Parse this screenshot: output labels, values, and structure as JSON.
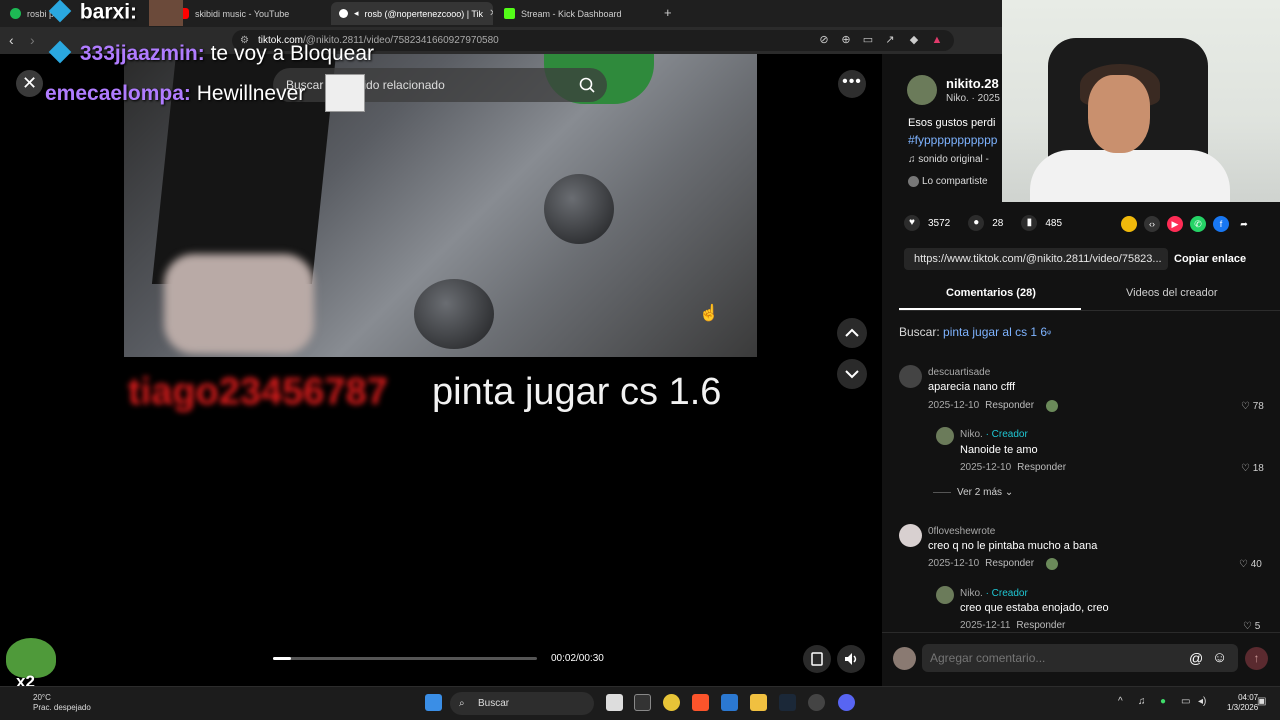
{
  "browser": {
    "tabs": [
      {
        "label": "rosbi pl...",
        "favicon_color": "#1db954",
        "active": false
      },
      {
        "label": "skibidi music - YouTube",
        "favicon_color": "#ff0000",
        "active": false
      },
      {
        "label": "rosb (@nopertenezcooo) | Tik",
        "favicon_color": "#ffffff",
        "active": true
      },
      {
        "label": "Stream - Kick Dashboard",
        "favicon_color": "#53fc18",
        "active": false
      }
    ],
    "new_tab": "+",
    "url_prefix": "tiktok.com",
    "url_path": "/@nikito.2811/video/7582341660927970580"
  },
  "chat_overlay": [
    {
      "user": "barxi:",
      "message": "",
      "user_color": "#ffffff"
    },
    {
      "user": "333jjaazmin:",
      "message": "te voy a Bloquear",
      "user_color": "#b07cff"
    },
    {
      "user": "emecaelompa:",
      "message": "Hewillnever",
      "user_color": "#b07cff"
    }
  ],
  "video": {
    "search_placeholder": "Buscar",
    "search_suffix": "ido relacionado",
    "caption_user": "tiago23456787",
    "caption_text": "pinta jugar cs 1.6",
    "time": "00:02/00:30",
    "progress_fraction": 0.067,
    "more": "•••",
    "close": "✕"
  },
  "post": {
    "author": "nikito.28",
    "author_sub": "Niko. · 2025",
    "description": "Esos gustos perdi",
    "hashtags": "#fyppppppppppp",
    "sound": "sonido original -",
    "shared": "Lo compartiste",
    "likes": "3572",
    "comments": "28",
    "saves": "485",
    "link": "https://www.tiktok.com/@nikito.2811/video/75823...",
    "copy_label": "Copiar enlace",
    "tab_comments": "Comentarios (28)",
    "tab_videos": "Videos del creador",
    "search_label": "Buscar:",
    "search_query": "pinta jugar al cs 1 6"
  },
  "comments": [
    {
      "user": "descuartisade",
      "badge": "",
      "text": "aparecia nano cfff",
      "date": "2025-12-10",
      "reply": "Responder",
      "likes": "78",
      "reply_level": 0
    },
    {
      "user": "Niko.",
      "badge": "· Creador",
      "text": "Nanoide te amo",
      "date": "2025-12-10",
      "reply": "Responder",
      "likes": "18",
      "reply_level": 1
    },
    {
      "user": "0floveshewrote",
      "badge": "",
      "text": "creo q no le pintaba mucho a bana",
      "date": "2025-12-10",
      "reply": "Responder",
      "likes": "40",
      "reply_level": 0
    },
    {
      "user": "Niko.",
      "badge": "· Creador",
      "text": "creo que estaba enojado, creo",
      "date": "2025-12-11",
      "reply": "Responder",
      "likes": "5",
      "reply_level": 1
    }
  ],
  "see_more": "Ver 2 más",
  "comment_input": {
    "placeholder": "Agregar comentario..."
  },
  "taskbar": {
    "temp": "20°C",
    "weather": "Prac. despejado",
    "search": "Buscar",
    "time": "04:07",
    "date": "1/3/2026"
  },
  "sticker_text": "x2"
}
